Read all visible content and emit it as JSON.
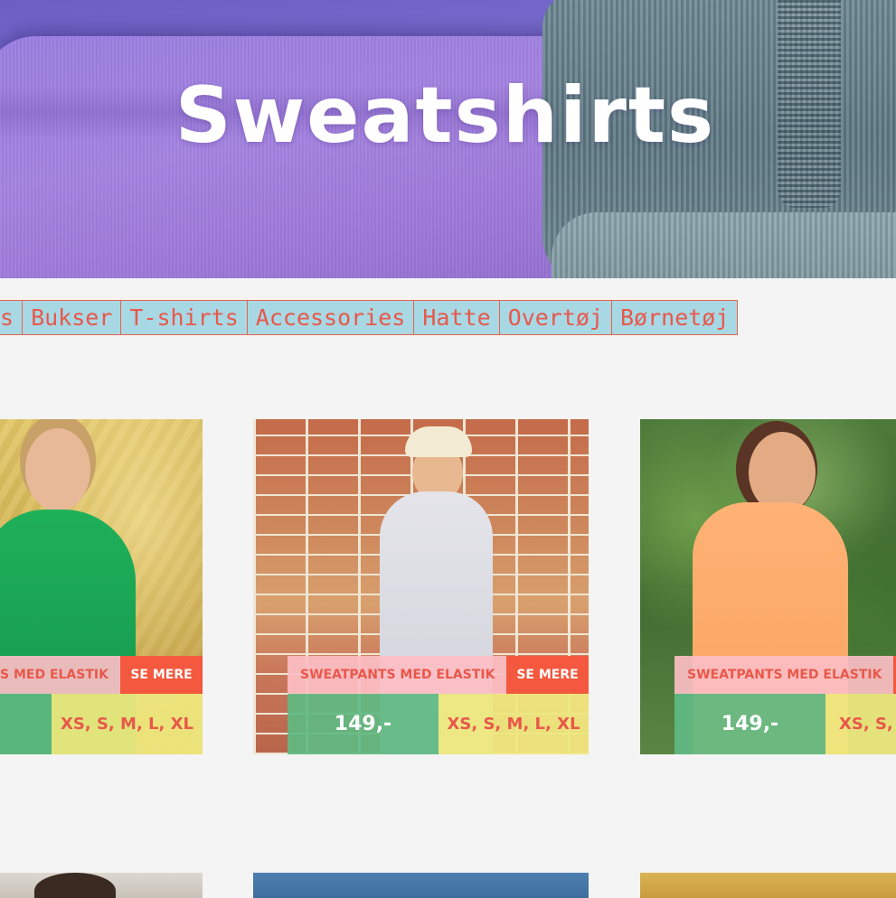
{
  "hero": {
    "title": "Sweatshirts"
  },
  "categories": [
    {
      "label": "s"
    },
    {
      "label": "Bukser"
    },
    {
      "label": "T-shirts"
    },
    {
      "label": "Accessories"
    },
    {
      "label": "Hatte"
    },
    {
      "label": "Overtøj"
    },
    {
      "label": "Børnetøj"
    }
  ],
  "products": [
    {
      "name": "S MED ELASTIK",
      "more_label": "SE MERE",
      "price": "",
      "sizes": "XS, S, M, L, XL",
      "colors": {
        "garment": "#18a552"
      }
    },
    {
      "name": "SWEATPANTS MED ELASTIK",
      "more_label": "SE MERE",
      "price": "149,-",
      "sizes": "XS, S, M, L, XL",
      "colors": {
        "garment": "#dcdce2"
      }
    },
    {
      "name": "SWEATPANTS MED ELASTIK",
      "more_label": "",
      "price": "149,-",
      "sizes": "XS, S,",
      "colors": {
        "garment": "#ffad6b"
      }
    }
  ],
  "theme": {
    "accent_red": "#e8584a",
    "nav_bg": "#a8d8e4",
    "name_bg": "#fcbec4",
    "price_bg": "#60ba82",
    "sizes_bg": "#eee87e",
    "button_bg": "#f4583e"
  }
}
